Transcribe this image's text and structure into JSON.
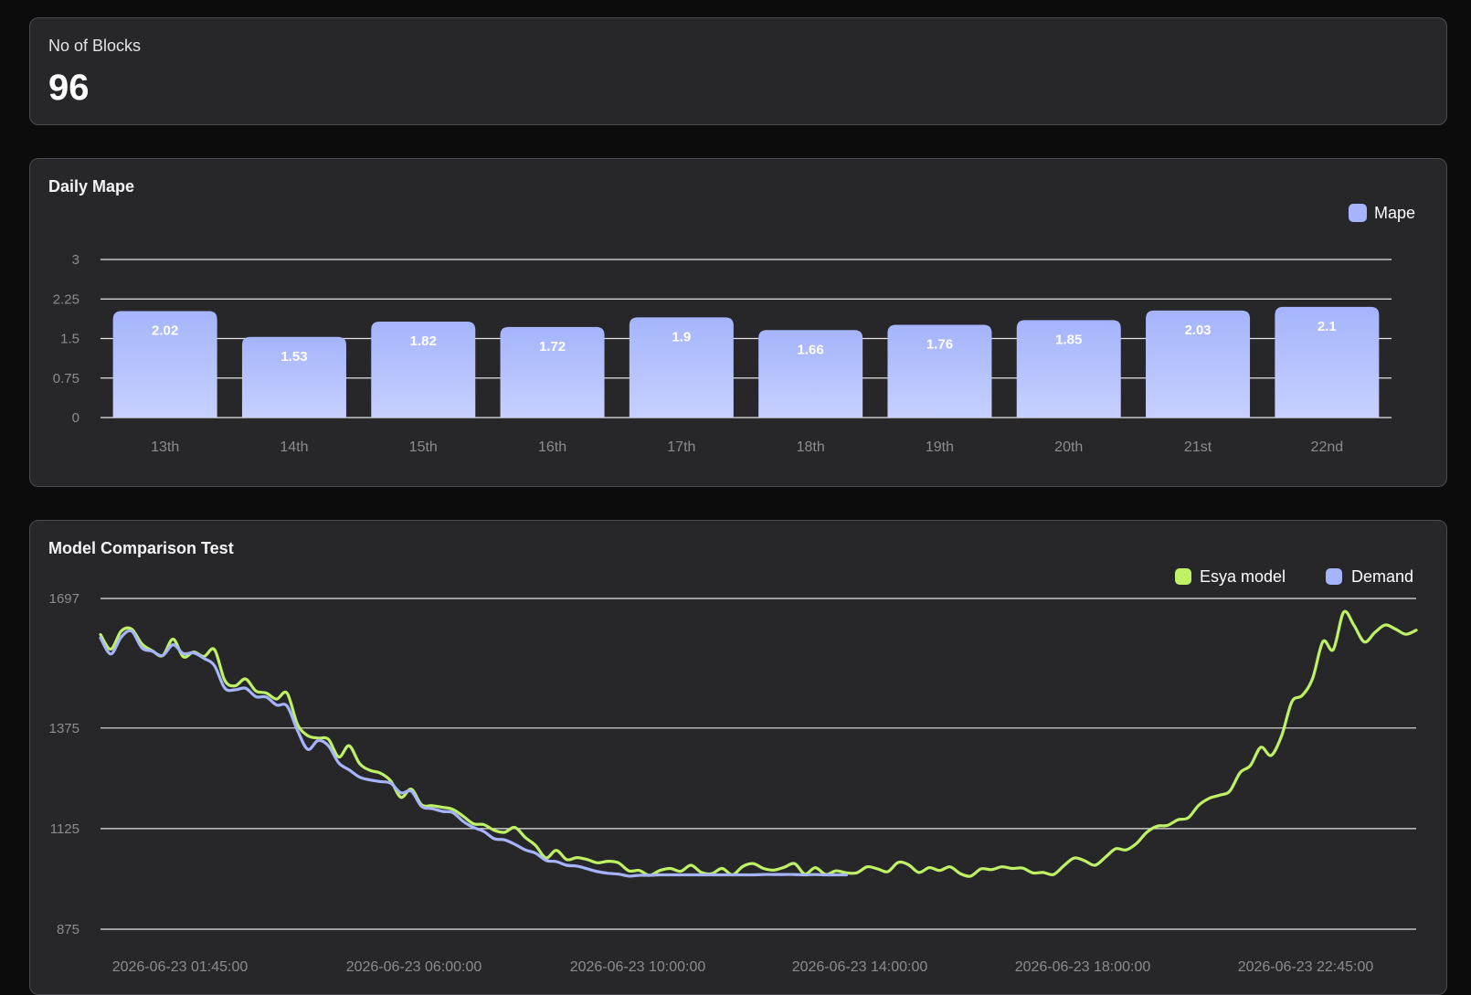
{
  "blocks": {
    "label": "No of Blocks",
    "value": "96"
  },
  "chart_data": [
    {
      "type": "bar",
      "title": "Daily Mape",
      "categories": [
        "13th",
        "14th",
        "15th",
        "16th",
        "17th",
        "18th",
        "19th",
        "20th",
        "21st",
        "22nd"
      ],
      "series": [
        {
          "name": "Mape",
          "values": [
            2.02,
            1.53,
            1.82,
            1.72,
            1.9,
            1.66,
            1.76,
            1.85,
            2.03,
            2.1
          ],
          "color": "#a5b4fc"
        }
      ],
      "yticks": [
        "0",
        "0.75",
        "1.5",
        "2.25",
        "3"
      ],
      "ylim": [
        0,
        3
      ],
      "grid": true,
      "legend": "top-right"
    },
    {
      "type": "line",
      "title": "Model Comparison Test",
      "yticks": [
        "875",
        "1125",
        "1375",
        "1697"
      ],
      "ylim": [
        875,
        1697
      ],
      "grid": true,
      "legend": "top-right",
      "xticks": [
        "2026-06-23 01:45:00",
        "2026-06-23 06:00:00",
        "2026-06-23 10:00:00",
        "2026-06-23 14:00:00",
        "2026-06-23 18:00:00",
        "2026-06-23 22:45:00"
      ],
      "series": [
        {
          "name": "Esya model",
          "color": "#bef264",
          "values": [
            1607,
            1571,
            1616,
            1621,
            1584,
            1567,
            1555,
            1596,
            1552,
            1564,
            1553,
            1570,
            1493,
            1480,
            1497,
            1467,
            1462,
            1447,
            1462,
            1385,
            1356,
            1350,
            1347,
            1303,
            1331,
            1287,
            1270,
            1263,
            1244,
            1203,
            1223,
            1184,
            1182,
            1178,
            1173,
            1156,
            1137,
            1135,
            1121,
            1116,
            1128,
            1103,
            1083,
            1052,
            1071,
            1048,
            1053,
            1048,
            1040,
            1044,
            1040,
            1020,
            1021,
            1009,
            1021,
            1026,
            1019,
            1034,
            1016,
            1013,
            1026,
            1010,
            1031,
            1038,
            1026,
            1022,
            1029,
            1038,
            1012,
            1028,
            1011,
            1020,
            1015,
            1015,
            1030,
            1025,
            1018,
            1041,
            1035,
            1016,
            1028,
            1021,
            1030,
            1013,
            1007,
            1025,
            1023,
            1030,
            1026,
            1027,
            1015,
            1016,
            1011,
            1033,
            1052,
            1045,
            1034,
            1054,
            1075,
            1072,
            1088,
            1116,
            1131,
            1133,
            1147,
            1152,
            1183,
            1200,
            1208,
            1218,
            1264,
            1282,
            1327,
            1307,
            1355,
            1440,
            1456,
            1498,
            1590,
            1570,
            1663,
            1630,
            1589,
            1612,
            1631,
            1621,
            1608,
            1618
          ]
        },
        {
          "name": "Demand",
          "color": "#a5b4fc",
          "values": [
            1599,
            1559,
            1601,
            1616,
            1574,
            1566,
            1555,
            1582,
            1560,
            1562,
            1548,
            1530,
            1474,
            1470,
            1474,
            1453,
            1452,
            1432,
            1430,
            1370,
            1322,
            1344,
            1331,
            1288,
            1271,
            1253,
            1246,
            1242,
            1238,
            1214,
            1218,
            1180,
            1175,
            1168,
            1165,
            1143,
            1128,
            1118,
            1100,
            1097,
            1086,
            1072,
            1064,
            1046,
            1043,
            1034,
            1032,
            1025,
            1018,
            1014,
            1012,
            1007,
            1009,
            1009,
            1010,
            1010,
            1010,
            1010,
            1010,
            1010,
            1010,
            1010,
            1010,
            1010,
            1011,
            1011,
            1011,
            1011,
            1010,
            1011,
            1010,
            1010,
            1010
          ]
        }
      ]
    }
  ]
}
